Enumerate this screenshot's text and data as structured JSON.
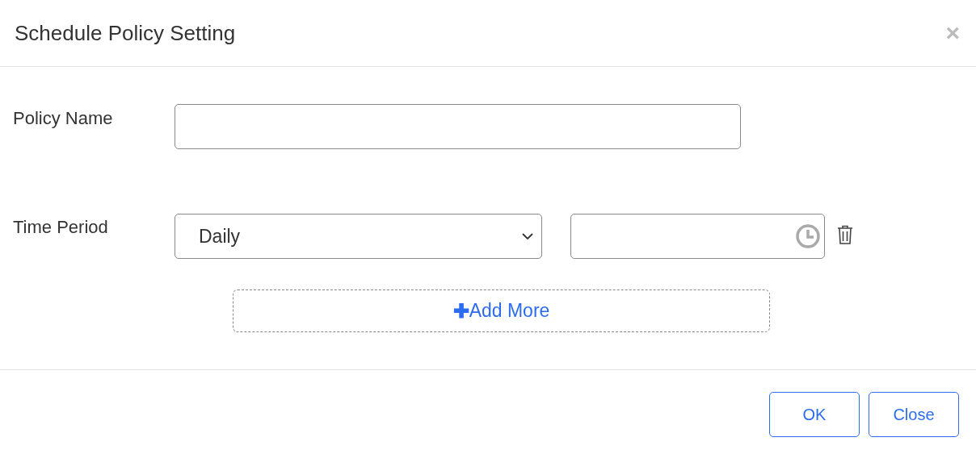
{
  "dialog": {
    "title": "Schedule Policy Setting",
    "close_glyph": "×"
  },
  "form": {
    "policy_name": {
      "label": "Policy Name"
    },
    "time_period": {
      "label": "Time Period",
      "rows": [
        {
          "frequency": "Daily"
        }
      ],
      "add_more": {
        "icon": "✚",
        "label": "Add More"
      }
    }
  },
  "buttons": [
    {
      "label": "OK"
    },
    {
      "label": "Close"
    }
  ]
}
